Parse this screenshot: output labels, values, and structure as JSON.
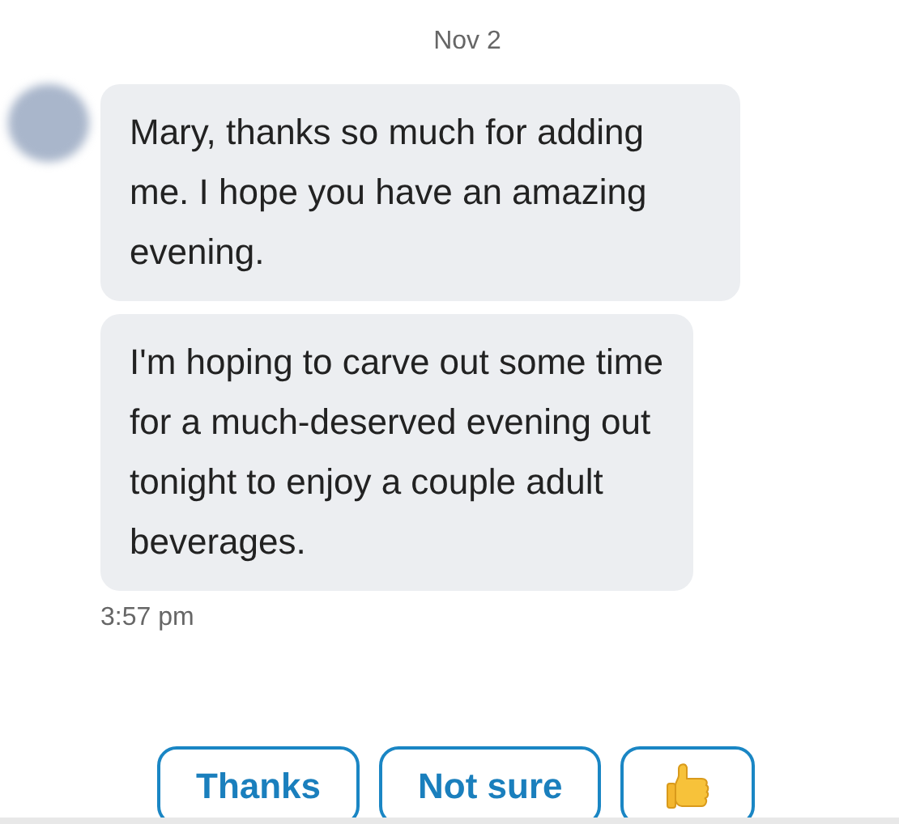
{
  "date_divider": "Nov 2",
  "messages": [
    {
      "text": "Mary, thanks so much for adding me. I hope you have an amazing evening."
    },
    {
      "text": "I'm hoping to carve out some time for a much-deserved evening out tonight to enjoy a couple adult beverages."
    }
  ],
  "timestamp": "3:57 pm",
  "quick_replies": [
    {
      "kind": "text",
      "label": "Thanks"
    },
    {
      "kind": "text",
      "label": "Not sure"
    },
    {
      "kind": "thumbs-up"
    }
  ]
}
